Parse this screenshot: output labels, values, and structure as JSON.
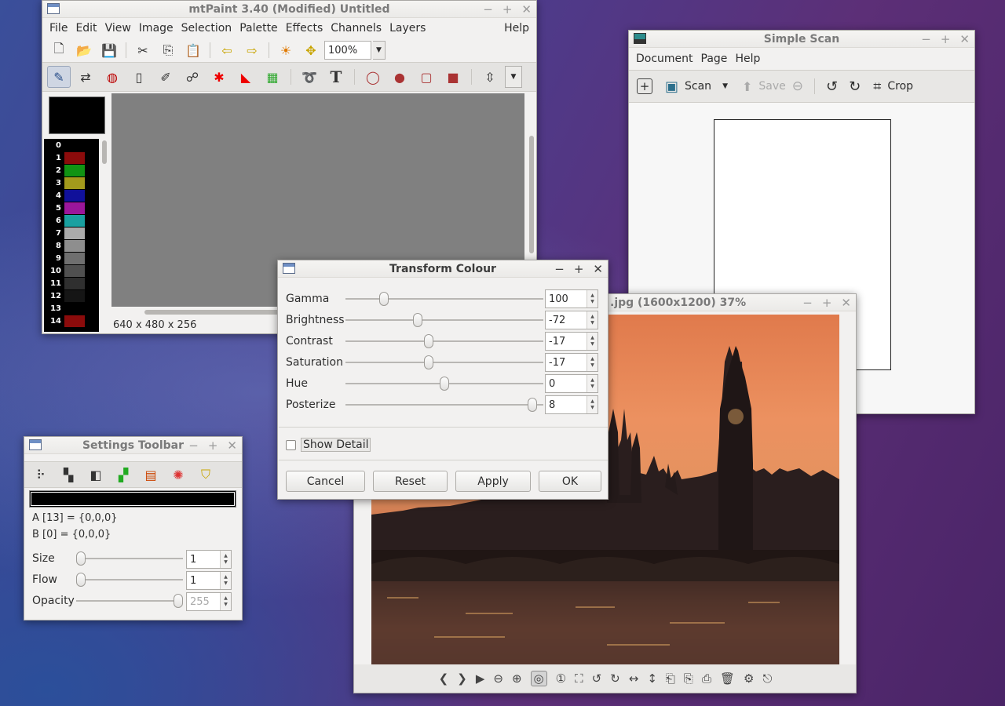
{
  "mtpaint": {
    "title": "mtPaint 3.40 (Modified) Untitled",
    "menu": [
      "File",
      "Edit",
      "View",
      "Image",
      "Selection",
      "Palette",
      "Effects",
      "Channels",
      "Layers"
    ],
    "help": "Help",
    "zoom": "100%",
    "status": "640 x 480 x 256",
    "palette": [
      {
        "n": "0",
        "color": "#000000"
      },
      {
        "n": "1",
        "color": "#8b0b0b"
      },
      {
        "n": "2",
        "color": "#119313"
      },
      {
        "n": "3",
        "color": "#a39a1c"
      },
      {
        "n": "4",
        "color": "#10109a"
      },
      {
        "n": "5",
        "color": "#9b169b"
      },
      {
        "n": "6",
        "color": "#19a0a0"
      },
      {
        "n": "7",
        "color": "#ababab"
      },
      {
        "n": "8",
        "color": "#8e8e8e"
      },
      {
        "n": "9",
        "color": "#6f6f6f"
      },
      {
        "n": "10",
        "color": "#505050"
      },
      {
        "n": "11",
        "color": "#2f2f2f"
      },
      {
        "n": "12",
        "color": "#151515"
      },
      {
        "n": "13",
        "color": "#000000"
      },
      {
        "n": "14",
        "color": "#8b0b0b"
      }
    ]
  },
  "scan": {
    "title": "Simple Scan",
    "menu": [
      "Document",
      "Page",
      "Help"
    ],
    "scan_label": "Scan",
    "save_label": "Save",
    "crop_label": "Crop"
  },
  "viewer": {
    "title_fragment": ".jpg (1600x1200) 37%"
  },
  "transform": {
    "title": "Transform Colour",
    "rows": [
      {
        "label": "Gamma",
        "value": "100",
        "pos": 0.18
      },
      {
        "label": "Brightness",
        "value": "-72",
        "pos": 0.36
      },
      {
        "label": "Contrast",
        "value": "-17",
        "pos": 0.415
      },
      {
        "label": "Saturation",
        "value": "-17",
        "pos": 0.415
      },
      {
        "label": "Hue",
        "value": "0",
        "pos": 0.5
      },
      {
        "label": "Posterize",
        "value": "8",
        "pos": 0.965
      }
    ],
    "show_detail": "Show Detail",
    "buttons": {
      "cancel": "Cancel",
      "reset": "Reset",
      "apply": "Apply",
      "ok": "OK"
    }
  },
  "settings": {
    "title": "Settings Toolbar",
    "a_info": "A [13] = {0,0,0}",
    "b_info": "B [0] = {0,0,0}",
    "rows": [
      {
        "label": "Size",
        "value": "1"
      },
      {
        "label": "Flow",
        "value": "1"
      },
      {
        "label": "Opacity",
        "value": "255"
      }
    ]
  }
}
